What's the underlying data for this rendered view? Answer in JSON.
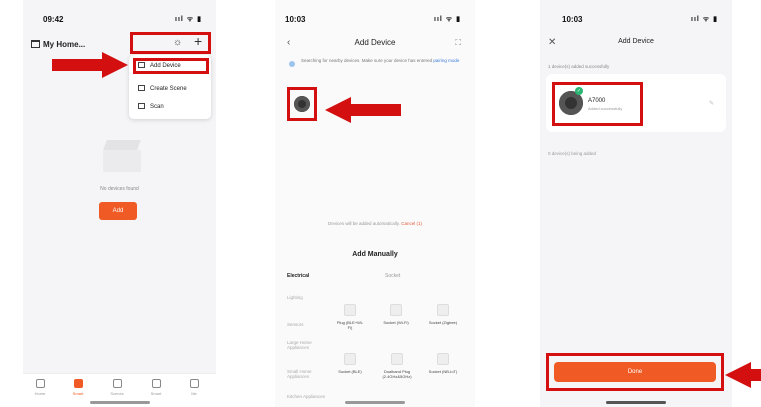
{
  "screen1": {
    "status_time": "09:42",
    "status_icons": "ııl ᯤ ▮",
    "home_title": "My Home",
    "menu": {
      "add_device": "Add Device",
      "create_scene": "Create Scene",
      "scan": "Scan"
    },
    "empty_text": "No devices found",
    "add_button": "Add",
    "tabs": [
      "Home",
      "Smart",
      "Scenes",
      "Smart",
      "Me"
    ]
  },
  "screen2": {
    "status_time": "10:03",
    "status_icons": "ııl ᯤ ▮",
    "nav_title": "Add Device",
    "searching_text": "Searching for nearby devices. Make sure your device has entered",
    "searching_link": "pairing mode",
    "auto_text": "Devices will be added automatically.",
    "auto_cancel": "Cancel (1)",
    "manual_title": "Add Manually",
    "category_tabs": [
      "Electrical",
      "Socket"
    ],
    "categories": [
      "Lighting",
      "Sensors",
      "Large Home Appliances",
      "Small Home Appliances",
      "Kitchen Appliances"
    ],
    "devices_row1": [
      "Plug (BLE+Wi-Fi)",
      "Socket (Wi-Fi)",
      "Socket (Zigbee)"
    ],
    "devices_row2": [
      "Socket (BLE)",
      "Dualband Plug (2.4GHz&5GHz)",
      "Socket (NB-IoT)"
    ]
  },
  "screen3": {
    "status_time": "10:03",
    "status_icons": "ııl ᯤ ▮",
    "nav_title": "Add Device",
    "added_text": "1 device(s) added successfully",
    "device_name": "A7000",
    "device_status": "Added successfully",
    "failed_text": "0 device(s) being added",
    "done_button": "Done"
  },
  "colors": {
    "accent": "#f05a24",
    "annotation": "#d40f0f",
    "success": "#2bb673"
  },
  "icons": [
    "home-icon",
    "bell-icon",
    "plus-icon",
    "add-device-icon",
    "scene-icon",
    "scan-icon",
    "back-icon",
    "scan-code-icon",
    "close-icon",
    "edit-icon",
    "check-icon",
    "camera-device-icon",
    "arrow-icon"
  ]
}
